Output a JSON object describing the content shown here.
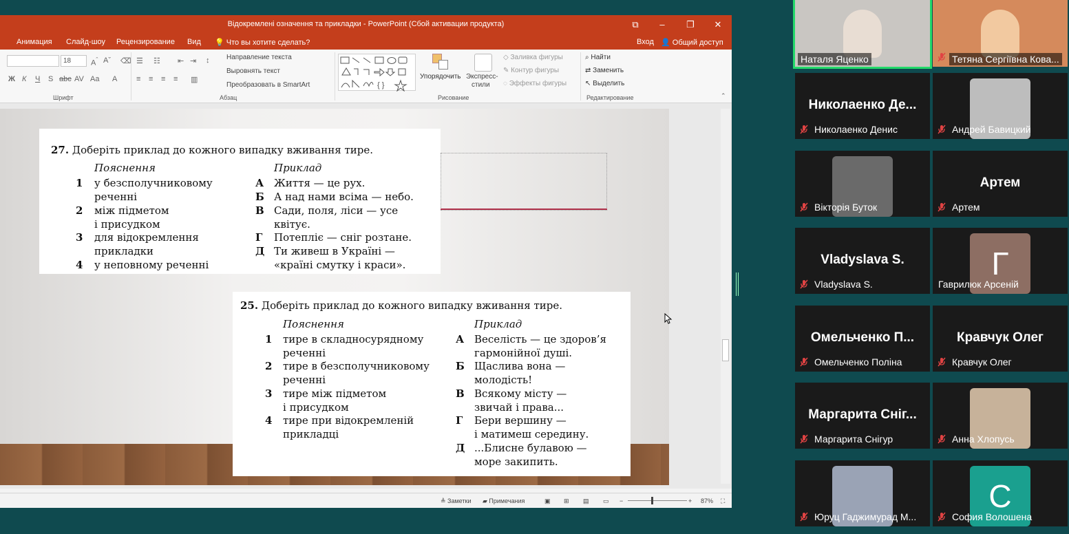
{
  "window": {
    "title": "Відокремлені означення та прикладки - PowerPoint (Сбой активации продукта)",
    "controls": [
      "⧉",
      "–",
      "❐",
      "✕"
    ]
  },
  "menu": {
    "items": [
      "Анимация",
      "Слайд-шоу",
      "Рецензирование",
      "Вид"
    ],
    "search": "Что вы хотите сделать?",
    "login": "Вход",
    "share": "Общий доступ"
  },
  "ribbon": {
    "font_size": "18",
    "group_font": "Шрифт",
    "group_paragraph": "Абзац",
    "group_drawing": "Рисование",
    "group_editing": "Редактирование",
    "text_direction": "Направление текста",
    "align_text": "Выровнять текст",
    "smartart": "Преобразовать в SmartArt",
    "arrange": "Упорядочить",
    "express_styles_1": "Экспресс-",
    "express_styles_2": "стили",
    "shape_fill": "Заливка фигуры",
    "shape_outline": "Контур фигуры",
    "shape_effects": "Эффекты фигуры",
    "find": "Найти",
    "replace": "Заменить",
    "select": "Выделить"
  },
  "slide": {
    "card1": {
      "number": "27.",
      "heading": "Доберіть приклад до кожного випадку вживання тире.",
      "col_left": "Пояснення",
      "col_right": "Приклад",
      "rows": [
        {
          "n": "1",
          "l1": "у безсполучниковому",
          "l2": "реченні"
        },
        {
          "n": "2",
          "l1": "між підметом",
          "l2": "і присудком"
        },
        {
          "n": "3",
          "l1": "для відокремлення",
          "l2": "прикладки"
        },
        {
          "n": "4",
          "l1": "у неповному реченні",
          "l2": ""
        }
      ],
      "examples": [
        {
          "k": "А",
          "l1": "Життя — це рух.",
          "l2": ""
        },
        {
          "k": "Б",
          "l1": "А над нами всіма — небо.",
          "l2": ""
        },
        {
          "k": "В",
          "l1": "Сади, поля, ліси — усе",
          "l2": "квітує."
        },
        {
          "k": "Г",
          "l1": "Потепліє — сніг розтане.",
          "l2": ""
        },
        {
          "k": "Д",
          "l1": "Ти живеш в Україні —",
          "l2": "«країні смутку і краси»."
        }
      ]
    },
    "card2": {
      "number": "25.",
      "heading": "Доберіть приклад до кожного випадку вживання тире.",
      "col_left": "Пояснення",
      "col_right": "Приклад",
      "rows": [
        {
          "n": "1",
          "l1": "тире в складносурядному",
          "l2": "реченні"
        },
        {
          "n": "2",
          "l1": "тире в безсполучниковому",
          "l2": "реченні"
        },
        {
          "n": "3",
          "l1": "тире між підметом",
          "l2": "і присудком"
        },
        {
          "n": "4",
          "l1": "тире при відокремленій",
          "l2": "прикладці"
        }
      ],
      "examples": [
        {
          "k": "А",
          "l1": "Веселість — це здоров’я",
          "l2": "гармонійної душі."
        },
        {
          "k": "Б",
          "l1": "Щаслива вона —",
          "l2": "молодість!"
        },
        {
          "k": "В",
          "l1": "Всякому місту —",
          "l2": "звичай і права..."
        },
        {
          "k": "Г",
          "l1": "Бери вершину —",
          "l2": "і матимеш середину."
        },
        {
          "k": "Д",
          "l1": "...Блисне булавою —",
          "l2": "море закипить."
        }
      ]
    }
  },
  "status": {
    "notes": "Заметки",
    "comments": "Примечания",
    "zoom": "87%"
  },
  "participants": [
    {
      "name": "Наталя Яценко",
      "video": true,
      "muted": false,
      "bg": "#c9c6c2",
      "active": true
    },
    {
      "name": "Тетяна Сергіївна Кова...",
      "video": true,
      "muted": true,
      "bg": "#d58a5c"
    },
    {
      "name": "Николаенко Денис",
      "big": "Николаенко  Де...",
      "muted": true
    },
    {
      "name": "Андрей Бавицкий",
      "avatar": "photo",
      "muted": true,
      "bg": "#bdbdbd"
    },
    {
      "name": "Вікторія Буток",
      "avatar": "photo",
      "muted": true,
      "bg": "#6a6a6a"
    },
    {
      "name": "Артем",
      "big": "Артем",
      "muted": true
    },
    {
      "name": "Vladyslava S.",
      "big": "Vladyslava S.",
      "muted": true
    },
    {
      "name": "Гаврилюк Арсеній",
      "avatar": "letter",
      "letter": "Г",
      "muted": false,
      "bg": "#8d6e63"
    },
    {
      "name": "Омельченко Поліна",
      "big": "Омельченко  П...",
      "muted": true
    },
    {
      "name": "Кравчук Олег",
      "big": "Кравчук Олег",
      "muted": true
    },
    {
      "name": "Маргарита Снігур",
      "big": "Маргарита  Сніг...",
      "muted": true
    },
    {
      "name": "Анна Хлопусь",
      "avatar": "photo",
      "muted": true,
      "bg": "#c7b29a"
    },
    {
      "name": "Юруц Гаджимурад М...",
      "avatar": "photo",
      "muted": true,
      "bg": "#9aa3b5"
    },
    {
      "name": "София Волошена",
      "avatar": "letter",
      "letter": "С",
      "muted": true,
      "bg": "#1aa08f"
    }
  ]
}
